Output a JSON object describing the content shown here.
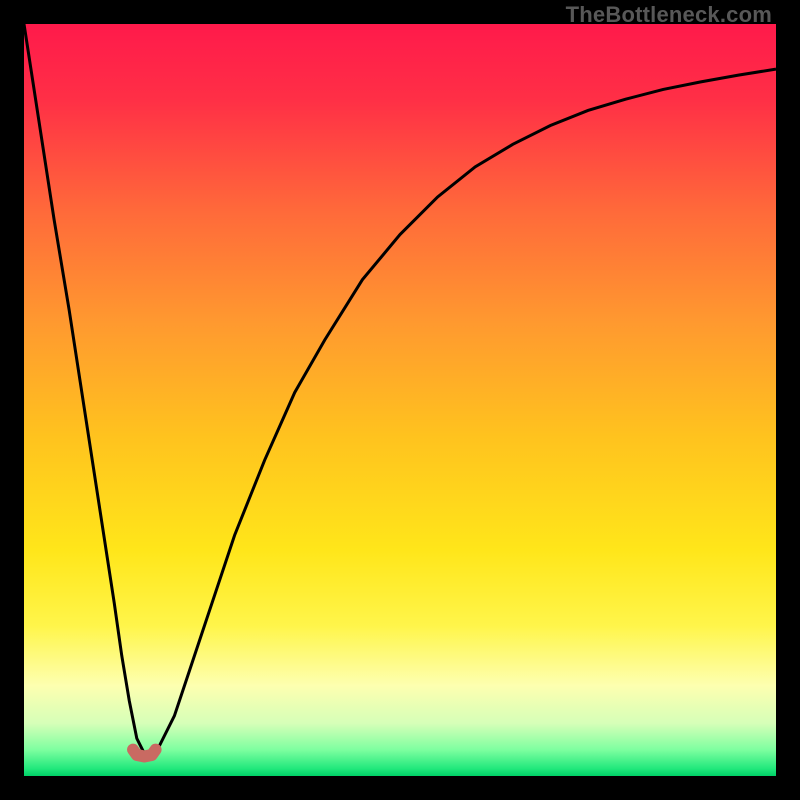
{
  "watermark": "TheBottleneck.com",
  "chart_data": {
    "type": "line",
    "title": "",
    "xlabel": "",
    "ylabel": "",
    "xlim": [
      0,
      100
    ],
    "ylim": [
      0,
      100
    ],
    "series": [
      {
        "name": "curve",
        "x": [
          0,
          2,
          4,
          6,
          8,
          10,
          12,
          13,
          14,
          15,
          16,
          17,
          18,
          20,
          22,
          25,
          28,
          32,
          36,
          40,
          45,
          50,
          55,
          60,
          65,
          70,
          75,
          80,
          85,
          90,
          95,
          100
        ],
        "values": [
          100,
          87,
          74,
          62,
          49,
          36,
          23,
          16,
          10,
          5,
          3,
          3,
          4,
          8,
          14,
          23,
          32,
          42,
          51,
          58,
          66,
          72,
          77,
          81,
          84,
          86.5,
          88.5,
          90,
          91.3,
          92.3,
          93.2,
          94
        ]
      },
      {
        "name": "minimum-marker",
        "x": [
          14.5,
          15.0,
          16.0,
          17.0,
          17.5
        ],
        "values": [
          3.5,
          2.8,
          2.6,
          2.8,
          3.5
        ]
      }
    ],
    "gradient_stops": [
      {
        "offset": 0.0,
        "color": "#ff1a4b"
      },
      {
        "offset": 0.1,
        "color": "#ff2f46"
      },
      {
        "offset": 0.25,
        "color": "#ff6a3a"
      },
      {
        "offset": 0.4,
        "color": "#ff9a2f"
      },
      {
        "offset": 0.55,
        "color": "#ffc31e"
      },
      {
        "offset": 0.7,
        "color": "#ffe61a"
      },
      {
        "offset": 0.8,
        "color": "#fff54a"
      },
      {
        "offset": 0.88,
        "color": "#fdffb0"
      },
      {
        "offset": 0.93,
        "color": "#d6ffb8"
      },
      {
        "offset": 0.965,
        "color": "#7effa0"
      },
      {
        "offset": 0.99,
        "color": "#22e87c"
      },
      {
        "offset": 1.0,
        "color": "#00d067"
      }
    ],
    "marker_color": "#c96a62",
    "curve_color": "#000000"
  }
}
